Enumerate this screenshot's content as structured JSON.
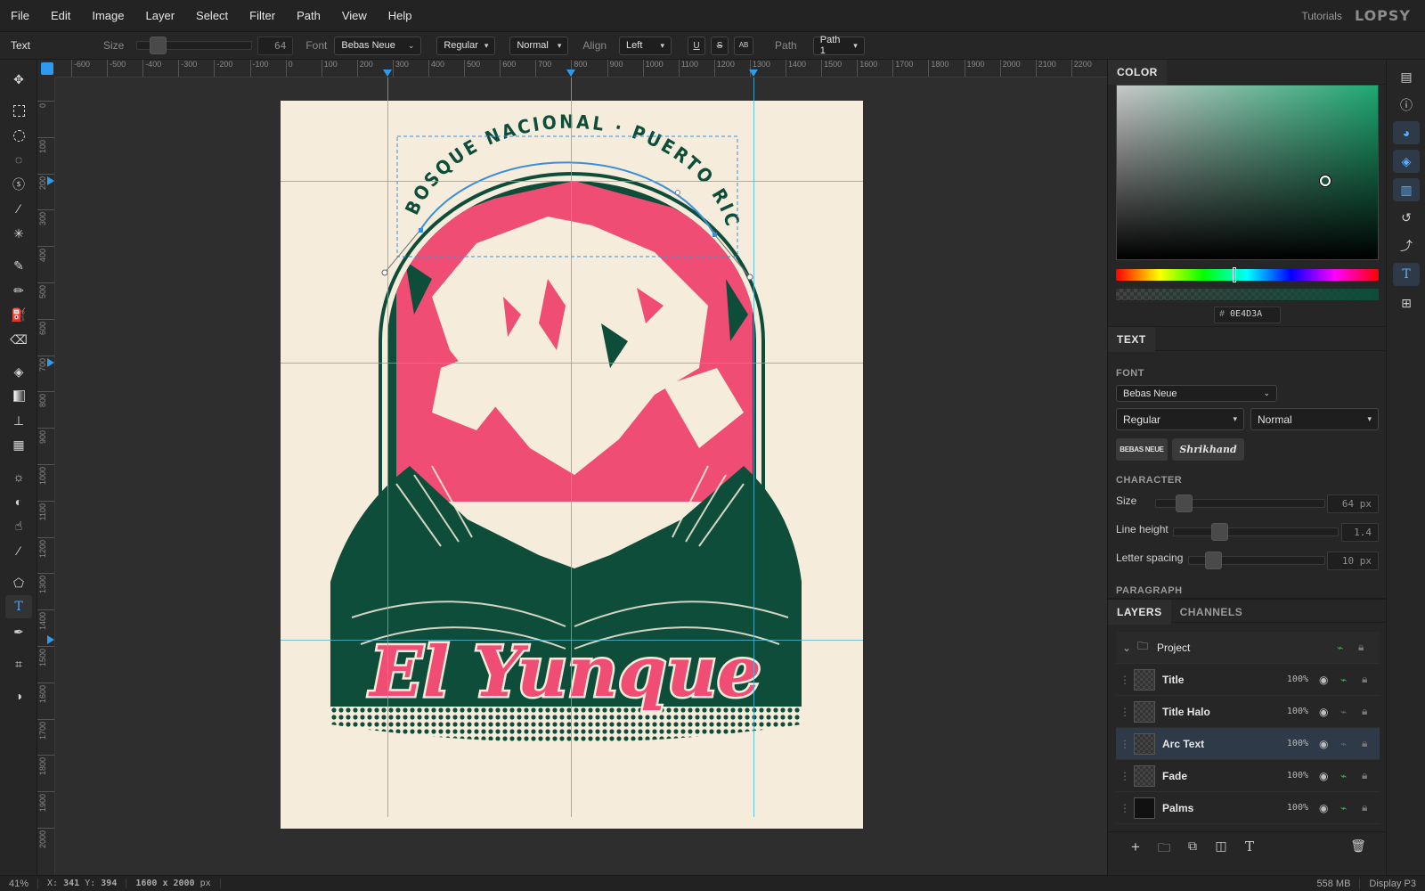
{
  "menu": {
    "items": [
      "File",
      "Edit",
      "Image",
      "Layer",
      "Select",
      "Filter",
      "Path",
      "View",
      "Help"
    ],
    "tutorials": "Tutorials",
    "logo": "LOPSY"
  },
  "options": {
    "tool_name": "Text",
    "size_label": "Size",
    "size_value": "64",
    "font_label": "Font",
    "font_value": "Bebas Neue",
    "style_value": "Regular",
    "weight_value": "Normal",
    "align_label": "Align",
    "align_value": "Left",
    "underline": "U",
    "strike": "S",
    "case_icon": "AB",
    "path_label": "Path",
    "path_value": "Path 1"
  },
  "rulers": {
    "h_ticks": [
      "-600",
      "-500",
      "-400",
      "-300",
      "-200",
      "-100",
      "0",
      "100",
      "200",
      "300",
      "400",
      "500",
      "600",
      "700",
      "800",
      "900",
      "1000",
      "1100",
      "1200",
      "1300",
      "1400",
      "1500",
      "1600",
      "1700",
      "1800",
      "1900",
      "2000",
      "2100",
      "2200"
    ],
    "v_ticks": [
      "0",
      "100",
      "200",
      "300",
      "400",
      "500",
      "600",
      "700",
      "800",
      "900",
      "1000",
      "1100",
      "1200",
      "1300",
      "1400",
      "1500",
      "1600",
      "1700",
      "1800",
      "1900",
      "2000"
    ]
  },
  "artwork": {
    "arc_text": "BOSQUE NACIONAL · PUERTO RICO",
    "title": "El Yunque"
  },
  "color_panel": {
    "tab": "COLOR",
    "hex_prefix": "#",
    "hex_value": "0E4D3A",
    "accent": "#0E4D3A"
  },
  "text_panel": {
    "tab": "TEXT",
    "font_label": "FONT",
    "font_family": "Bebas Neue",
    "style": "Regular",
    "weight": "Normal",
    "preset_1": "BEBAS NEUE",
    "preset_2": "Shrikhand",
    "character_label": "CHARACTER",
    "size_label": "Size",
    "size_value": "64 px",
    "line_height_label": "Line height",
    "line_height_value": "1.4",
    "letter_spacing_label": "Letter spacing",
    "letter_spacing_value": "10 px",
    "paragraph_label": "PARAGRAPH"
  },
  "layers_panel": {
    "tab_layers": "LAYERS",
    "tab_channels": "CHANNELS",
    "group_name": "Project",
    "layers": [
      {
        "name": "Title",
        "opacity": "100%"
      },
      {
        "name": "Title Halo",
        "opacity": "100%"
      },
      {
        "name": "Arc Text",
        "opacity": "100%"
      },
      {
        "name": "Fade",
        "opacity": "100%"
      },
      {
        "name": "Palms",
        "opacity": "100%"
      }
    ]
  },
  "status": {
    "zoom": "41%",
    "x_label": "X:",
    "x_value": "341",
    "y_label": "Y:",
    "y_value": "394",
    "doc_size": "1600 x 2000",
    "doc_unit": "px",
    "memory": "558 MB",
    "color_profile": "Display P3"
  }
}
